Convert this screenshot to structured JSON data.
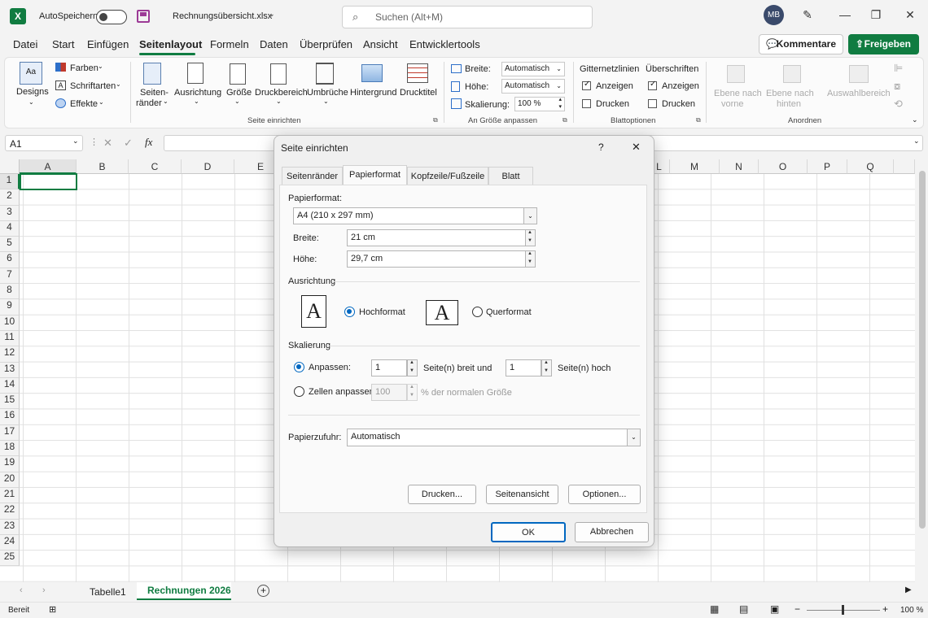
{
  "titlebar": {
    "autosave": "AutoSpeichern",
    "filename": "Rechnungsübersicht.xlsx",
    "search_placeholder": "Suchen (Alt+M)",
    "avatar": "MB"
  },
  "menu": {
    "items": [
      "Datei",
      "Start",
      "Einfügen",
      "Seitenlayout",
      "Formeln",
      "Daten",
      "Überprüfen",
      "Ansicht",
      "Entwicklertools"
    ],
    "active": "Seitenlayout",
    "comments": "Kommentare",
    "share": "Freigeben"
  },
  "ribbon": {
    "designs": "Designs",
    "farben": "Farben",
    "schriftarten": "Schriftarten",
    "effekte": "Effekte",
    "seitenraender_1": "Seiten-",
    "seitenraender_2": "ränder",
    "ausrichtung": "Ausrichtung",
    "groesse": "Größe",
    "druckbereich": "Druckbereich",
    "umbrueche": "Umbrüche",
    "hintergrund": "Hintergrund",
    "drucktitel": "Drucktitel",
    "grp_seite": "Seite einrichten",
    "breite_label": "Breite:",
    "breite_value": "Automatisch",
    "hoehe_label": "Höhe:",
    "hoehe_value": "Automatisch",
    "skalierung_label": "Skalierung:",
    "skalierung_value": "100 %",
    "grp_groesse": "An Größe anpassen",
    "gitter_title": "Gitternetzlinien",
    "ueber_title": "Überschriften",
    "anzeigen": "Anzeigen",
    "drucken": "Drucken",
    "grp_blatt": "Blattoptionen",
    "ebene_vorne_1": "Ebene nach",
    "ebene_vorne_2": "vorne",
    "ebene_hinten_1": "Ebene nach",
    "ebene_hinten_2": "hinten",
    "auswahlbereich": "Auswahlbereich",
    "grp_anordnen": "Anordnen"
  },
  "formula": {
    "namebox": "A1",
    "fx": "fx"
  },
  "grid": {
    "columns": [
      "A",
      "B",
      "C",
      "D",
      "E",
      "L",
      "M",
      "N",
      "O",
      "P",
      "Q"
    ],
    "rows": [
      "1",
      "2",
      "3",
      "4",
      "5",
      "6",
      "7",
      "8",
      "9",
      "10",
      "11",
      "12",
      "13",
      "14",
      "15",
      "16",
      "17",
      "18",
      "19",
      "20",
      "21",
      "22",
      "23",
      "24",
      "25"
    ]
  },
  "sheets": {
    "tab1": "Tabelle1",
    "tab2": "Rechnungen 2026"
  },
  "status": {
    "ready": "Bereit",
    "zoom": "100 %"
  },
  "dialog": {
    "title": "Seite einrichten",
    "help": "?",
    "tabs": [
      "Seitenränder",
      "Papierformat",
      "Kopfzeile/Fußzeile",
      "Blatt"
    ],
    "papierformat_label": "Papierformat:",
    "papierformat_value": "A4 (210 x 297 mm)",
    "breite_label": "Breite:",
    "breite_value": "21 cm",
    "hoehe_label": "Höhe:",
    "hoehe_value": "29,7 cm",
    "ausrichtung_label": "Ausrichtung",
    "page_letter": "A",
    "hochformat": "Hochformat",
    "querformat": "Querformat",
    "skalierung_label": "Skalierung",
    "anpassen": "Anpassen:",
    "anpassen_breit": "1",
    "breit_text": "Seite(n) breit und",
    "anpassen_hoch": "1",
    "hoch_text": "Seite(n) hoch",
    "zellen_anpassen": "Zellen anpassen:",
    "zellen_value": "100",
    "zellen_text": "% der normalen Größe",
    "papierzufuhr_label": "Papierzufuhr:",
    "papierzufuhr_value": "Automatisch",
    "btn_drucken": "Drucken...",
    "btn_seitenansicht": "Seitenansicht",
    "btn_optionen": "Optionen...",
    "btn_ok": "OK",
    "btn_abbrechen": "Abbrechen"
  }
}
